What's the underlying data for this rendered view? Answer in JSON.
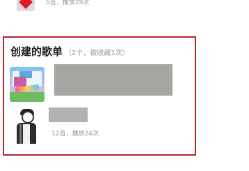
{
  "top_item": {
    "meta": "5首，播放29次"
  },
  "created_playlists": {
    "title": "创建的歌单",
    "subtitle": "（2个，被收藏1次）",
    "items": [
      {
        "name": "",
        "meta": ""
      },
      {
        "name": "",
        "meta": "12首，播放24次"
      }
    ]
  },
  "colors": {
    "accent_red": "#b5242c",
    "heart_red": "#e0192a",
    "redaction_gray": "#a3a6a1"
  }
}
